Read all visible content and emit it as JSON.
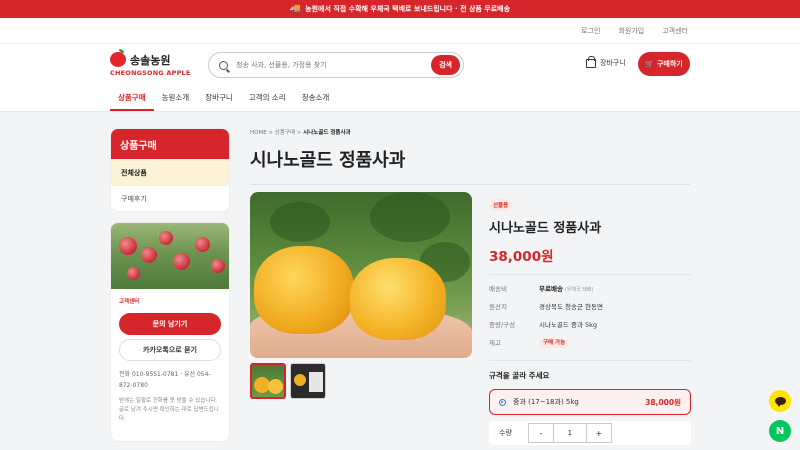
{
  "topbar": {
    "text": "농원에서 직접 수확해 우체국 택배로 보내드립니다 · 전 상품 무료배송"
  },
  "util": {
    "login": "로그인",
    "join": "회원가입",
    "cs": "고객센터"
  },
  "header": {
    "brand_ko": "송솔농원",
    "brand_en": "CHEONGSONG APPLE",
    "search_placeholder": "청송 사과, 선물용, 가정용 찾기",
    "search_button": "검색",
    "cart_label": "장바구니",
    "buy_label": "구매하기"
  },
  "nav": [
    "상품구매",
    "농원소개",
    "장바구니",
    "고객의 소리",
    "청송소개"
  ],
  "sidebar": {
    "title": "상품구매",
    "items": [
      "전체상품",
      "구매후기"
    ],
    "card_label": "고객센터",
    "inquiry_button": "문의 남기기",
    "kakao_button": "카카오톡으로 묻기",
    "phone": "전화 010-9551-0781 · 유선 054-872-0780",
    "note": "받에는 일할로 전화를 못 받을 수 있습니다. 글로 남겨 주시면 확인하는 대로 답변드립니다."
  },
  "main": {
    "breadcrumb_home": "HOME",
    "breadcrumb_mid": "상품구매",
    "breadcrumb_current": "시나노골드 정품사과",
    "title": "시나노골드 정품사과"
  },
  "product": {
    "tag": "선물용",
    "name": "시나노골드 정품사과",
    "price": "38,000원",
    "rows": [
      {
        "key": "배송비",
        "value": "무료배송",
        "sub": "(우체국 택배)"
      },
      {
        "key": "원산지",
        "value": "경상북도 청송군 현동면"
      },
      {
        "key": "중량/구성",
        "value": "시나노골드 중과 5kg"
      },
      {
        "key": "재고",
        "value": "구매 가능"
      }
    ],
    "select_label": "규격을 골라 주세요",
    "option_name": "중과 (17~18과) 5kg",
    "option_price": "38,000원",
    "qty_label": "수량",
    "qty_minus": "-",
    "qty_value": "1",
    "qty_plus": "+"
  },
  "colors": {
    "accent": "#d7262b",
    "background": "#f3f4f6"
  },
  "icons": {
    "truck": "truck-icon",
    "search": "search-icon",
    "cart": "cart-icon",
    "kakao": "kakao-chat-icon",
    "naver": "naver-icon"
  }
}
